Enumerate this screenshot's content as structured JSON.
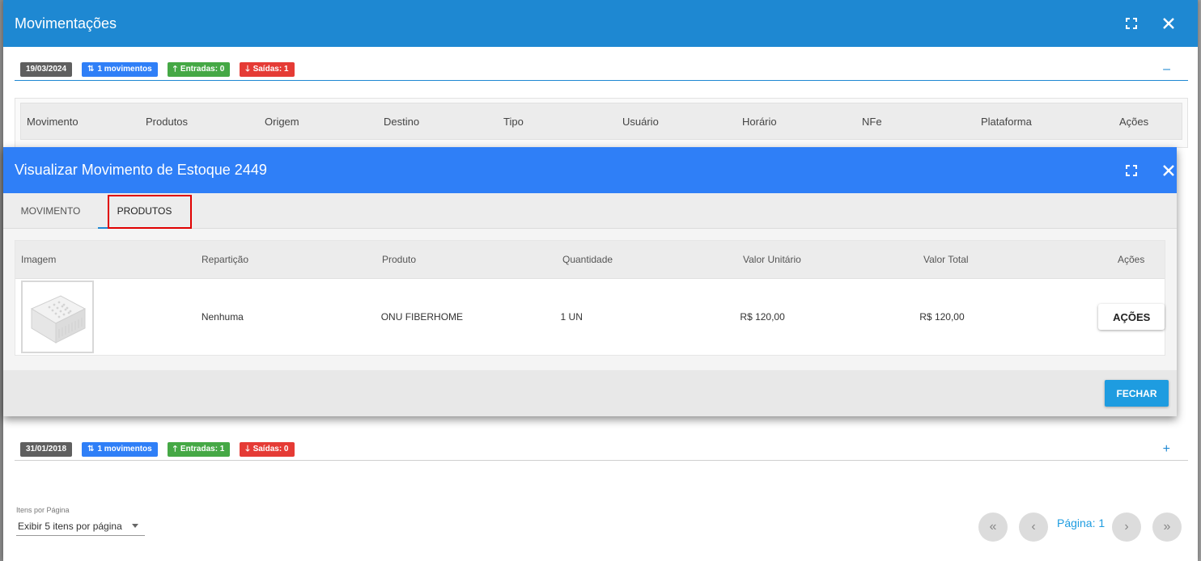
{
  "outer": {
    "title": "Movimentações",
    "groups": [
      {
        "date": "19/03/2024",
        "movimentos": "1 movimentos",
        "entradas": "Entradas: 0",
        "saidas": "Saídas: 1",
        "toggle": "–"
      },
      {
        "date": "31/01/2018",
        "movimentos": "1 movimentos",
        "entradas": "Entradas: 1",
        "saidas": "Saídas: 0",
        "toggle": "+"
      }
    ],
    "table_headers": [
      "Movimento",
      "Produtos",
      "Origem",
      "Destino",
      "Tipo",
      "Usuário",
      "Horário",
      "NFe",
      "Plataforma",
      "Ações"
    ],
    "pagination": {
      "label": "Itens por Página",
      "select_value": "Exibir 5 itens por página",
      "page_text": "Página: 1"
    }
  },
  "inner": {
    "title": "Visualizar Movimento de Estoque 2449",
    "tabs": [
      "MOVIMENTO",
      "PRODUTOS"
    ],
    "active_tab": "PRODUTOS",
    "table_headers": [
      "Imagem",
      "Repartição",
      "Produto",
      "Quantidade",
      "Valor Unitário",
      "Valor Total",
      "Ações"
    ],
    "rows": [
      {
        "image_alt": "onu-device-image",
        "reparticao": "Nenhuma",
        "produto": "ONU FIBERHOME",
        "quantidade": "1 UN",
        "valor_unitario": "R$ 120,00",
        "valor_total": "R$ 120,00",
        "acoes_label": "AÇÕES"
      }
    ],
    "close_button": "FECHAR"
  },
  "colors": {
    "outer_header": "#1e88d2",
    "inner_header": "#2f7ff7",
    "chip_date": "#5f5f5f",
    "chip_blue": "#2f7ff7",
    "chip_green": "#45a845",
    "chip_red": "#e53b35",
    "accent": "#1e9ce0",
    "tab_highlight": "#e00000"
  },
  "icons": {
    "fullscreen": "fullscreen-icon",
    "close": "close-icon",
    "arrows_updown": "swap-vertical-icon",
    "arrow_up": "arrow-up-icon",
    "arrow_down": "arrow-down-icon",
    "first_page": "double-chevron-left-icon",
    "prev_page": "chevron-left-icon",
    "next_page": "chevron-right-icon",
    "last_page": "double-chevron-right-icon"
  }
}
